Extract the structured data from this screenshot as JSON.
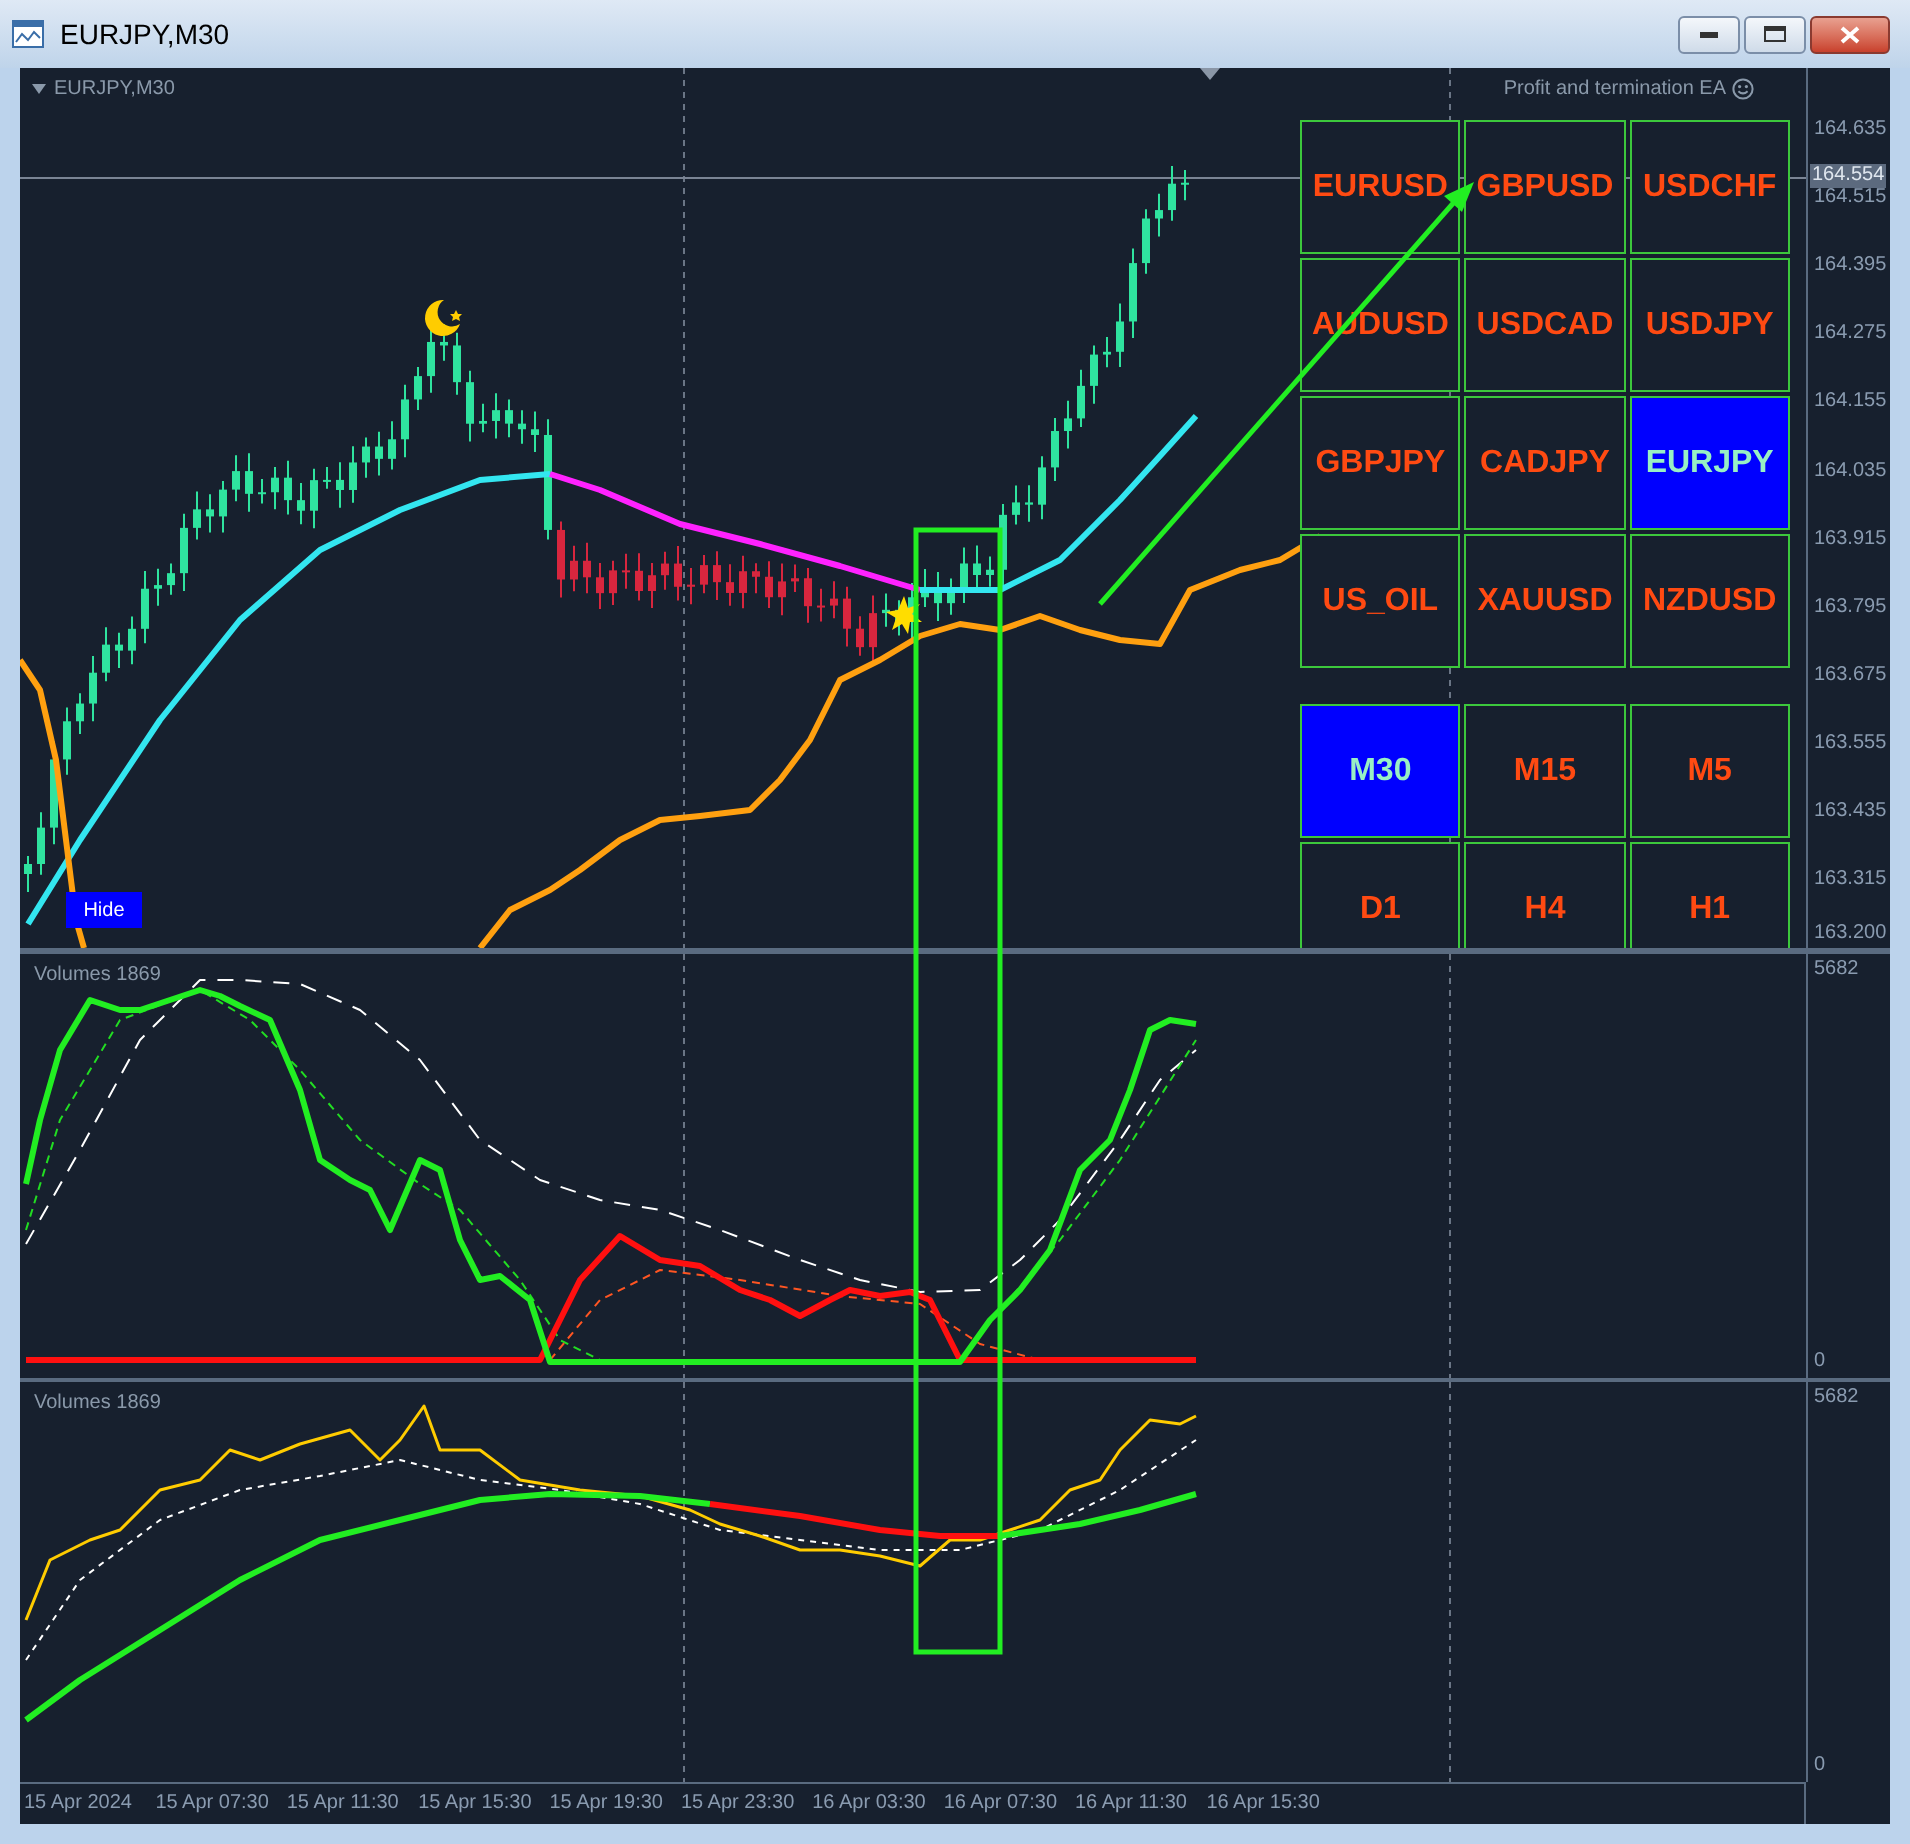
{
  "window": {
    "title": "EURJPY,M30"
  },
  "chart": {
    "symbol_label": "EURJPY,M30",
    "ea_label": "Profit and termination EA",
    "hide_button": "Hide"
  },
  "symbols": [
    {
      "label": "EURUSD",
      "selected": false
    },
    {
      "label": "GBPUSD",
      "selected": false
    },
    {
      "label": "USDCHF",
      "selected": false
    },
    {
      "label": "AUDUSD",
      "selected": false
    },
    {
      "label": "USDCAD",
      "selected": false
    },
    {
      "label": "USDJPY",
      "selected": false
    },
    {
      "label": "GBPJPY",
      "selected": false
    },
    {
      "label": "CADJPY",
      "selected": false
    },
    {
      "label": "EURJPY",
      "selected": true
    },
    {
      "label": "US_OIL",
      "selected": false
    },
    {
      "label": "XAUUSD",
      "selected": false
    },
    {
      "label": "NZDUSD",
      "selected": false
    }
  ],
  "timeframes": [
    {
      "label": "M30",
      "selected": true
    },
    {
      "label": "M15",
      "selected": false
    },
    {
      "label": "M5",
      "selected": false
    },
    {
      "label": "D1",
      "selected": false
    },
    {
      "label": "H4",
      "selected": false
    },
    {
      "label": "H1",
      "selected": false
    }
  ],
  "price_axis": {
    "ticks": [
      "164.635",
      "164.515",
      "164.395",
      "164.275",
      "164.155",
      "164.035",
      "163.915",
      "163.795",
      "163.675",
      "163.555",
      "163.435",
      "163.315",
      "163.200"
    ],
    "current_price": "164.554"
  },
  "indicators": [
    {
      "title": "Volumes 1869",
      "max": "5682",
      "min": "0"
    },
    {
      "title": "Volumes 1869",
      "max": "5682",
      "min": "0"
    }
  ],
  "time_axis": [
    "15 Apr 2024",
    "15 Apr 07:30",
    "15 Apr 11:30",
    "15 Apr 15:30",
    "15 Apr 19:30",
    "15 Apr 23:30",
    "16 Apr 03:30",
    "16 Apr 07:30",
    "16 Apr 11:30",
    "16 Apr 15:30"
  ]
}
